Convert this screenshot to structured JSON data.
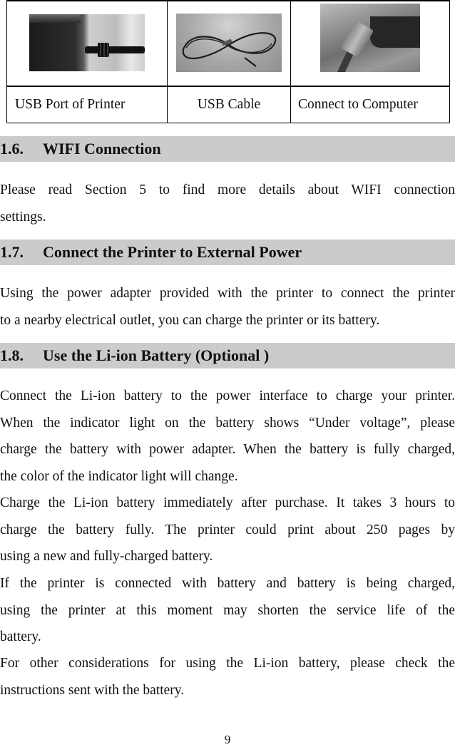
{
  "figure_table": {
    "images": [
      {
        "icon": "usb-port-of-printer-photo",
        "alt": "USB port of printer photo"
      },
      {
        "icon": "usb-cable-photo",
        "alt": "USB cable photo"
      },
      {
        "icon": "connect-to-computer-photo",
        "alt": "USB plug connected to computer photo"
      }
    ],
    "captions": [
      "USB Port of Printer",
      "USB Cable",
      "Connect to Computer"
    ]
  },
  "sections": [
    {
      "number": "1.6.",
      "title": "WIFI Connection",
      "lines": [
        "Please read Section 5 to find more details about WIFI connection",
        "settings."
      ]
    },
    {
      "number": "1.7.",
      "title": "Connect the Printer to External Power",
      "lines": [
        "Using the power adapter provided with the printer to connect the printer",
        "to a nearby electrical outlet, you can charge the printer or its battery."
      ]
    },
    {
      "number": "1.8.",
      "title": "Use the Li-ion Battery (Optional )",
      "paragraphs": [
        {
          "lines": [
            "Connect the Li-ion battery to the power interface to charge your printer.",
            "When the indicator light on the battery shows “Under voltage”, please",
            "charge the battery with power adapter. When the battery is fully charged,",
            "the color of the indicator light will change."
          ]
        },
        {
          "lines": [
            "Charge the Li-ion battery immediately after purchase. It takes 3 hours to",
            "charge the battery fully. The printer could print about 250 pages by",
            "using a new and fully-charged battery."
          ]
        },
        {
          "lines": [
            "If the printer is connected with battery and battery is being charged,",
            "using the printer at this moment may shorten the service life of the",
            "battery."
          ]
        },
        {
          "lines": [
            "For other considerations for using the Li-ion battery, please check the",
            "instructions sent with the battery."
          ]
        }
      ]
    }
  ],
  "page_number": "9",
  "colors": {
    "heading_bar": "#cbcbcb",
    "text": "#111111",
    "border": "#000000"
  }
}
